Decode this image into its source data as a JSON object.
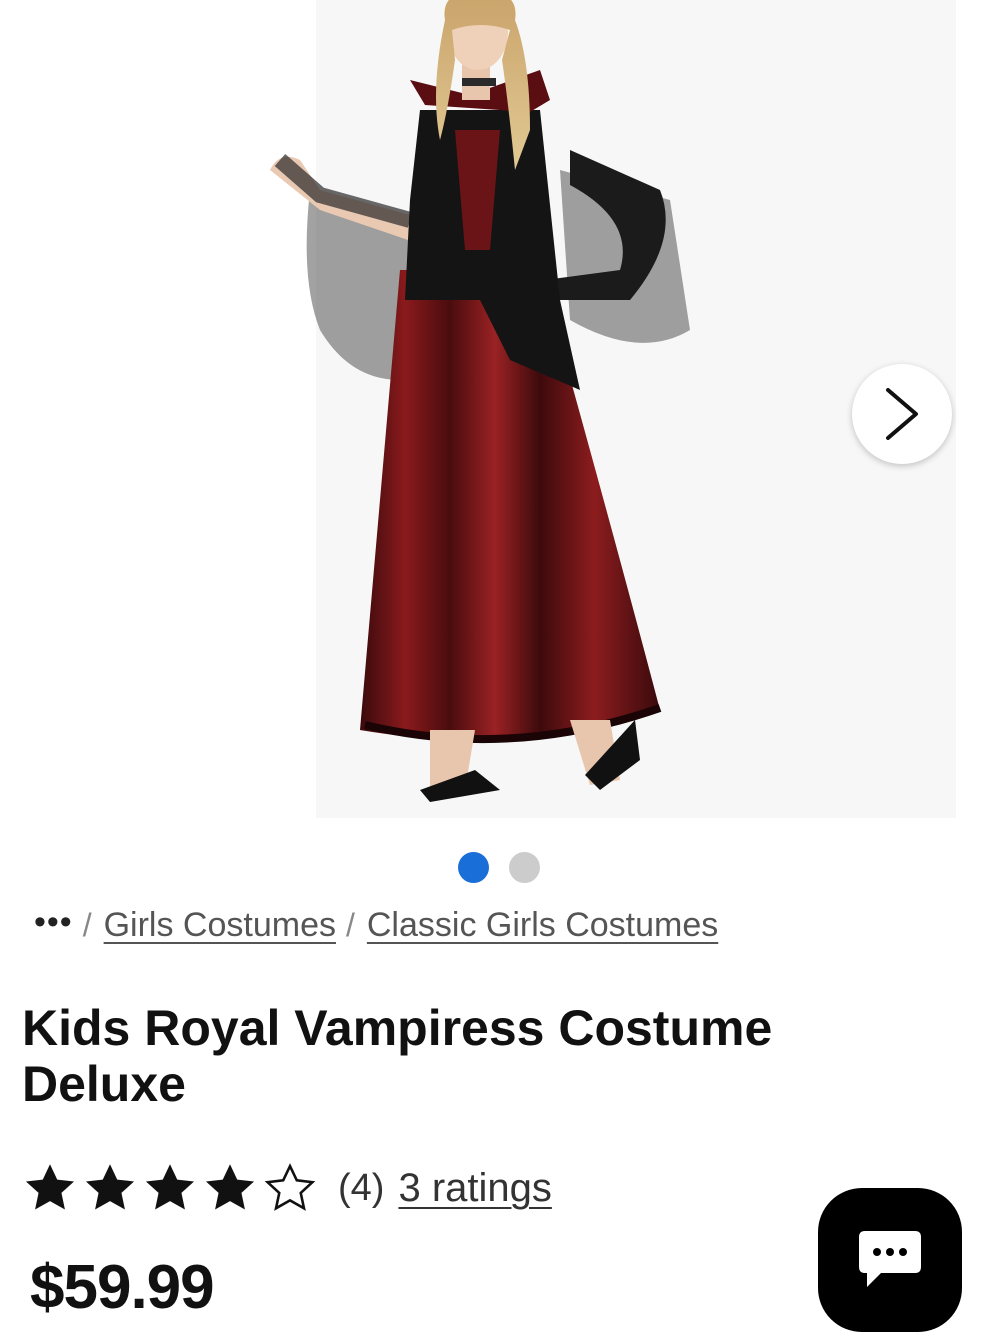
{
  "product": {
    "title": "Kids Royal Vampiress Costume Deluxe",
    "price": "$59.99",
    "image_alt": "Girl wearing a black and red vampiress gown with sheer bell sleeves and high collar"
  },
  "carousel": {
    "next_icon": "chevron-right-icon",
    "slide_count": 2,
    "active_slide": 1
  },
  "breadcrumb": {
    "more_label": "•••",
    "separator": "/",
    "items": [
      "Girls Costumes",
      "Classic Girls Costumes"
    ]
  },
  "rating": {
    "stars_filled": 4,
    "stars_total": 5,
    "count_label": "(4)",
    "ratings_link": "3 ratings"
  },
  "chat": {
    "icon": "chat-bubble-icon"
  },
  "colors": {
    "accent": "#1a6ed8",
    "dot_inactive": "#cccccc",
    "text": "#111111",
    "chat_bg": "#000000"
  }
}
